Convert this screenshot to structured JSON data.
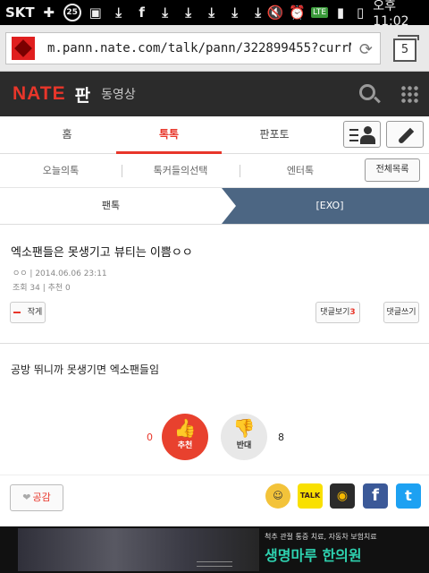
{
  "status_bar": {
    "carrier": "SKT",
    "badge": "25",
    "time": "오후 11:02",
    "lte": "LTE"
  },
  "browser": {
    "url": "m.pann.nate.com/talk/pann/322899455?currMenu=cl",
    "tab_count": "5"
  },
  "header": {
    "logo": "NATE",
    "section": "판",
    "video": "동영상"
  },
  "main_tabs": [
    "홈",
    "톡톡",
    "판포토"
  ],
  "sub_tabs": {
    "items": [
      "오늘의톡",
      "톡커들의선택",
      "엔터톡"
    ],
    "all_button": "전체목록"
  },
  "breadcrumb": {
    "left": "팬톡",
    "right": "[EXO]"
  },
  "post": {
    "title": "엑소팬들은 못생기고 뷰티는 이쁨ㅇㅇ",
    "meta": "ㅇㅇ | 2014.06.06 23:11",
    "stats": "조회 34 | 추천 0",
    "write_button": "작게",
    "comments_button": "댓글보기",
    "comments_count": "3",
    "write_comment_button": "댓글쓰기"
  },
  "content": {
    "text": "공방 뛰니까 못생기면 엑소팬들임"
  },
  "vote": {
    "up_label": "추천",
    "up_count": "0",
    "down_label": "반대",
    "down_count": "8"
  },
  "share": {
    "like_label": "공감",
    "talk_label": "TALK",
    "facebook_label": "f",
    "twitter_label": "t"
  },
  "ad": {
    "sub": "척추 관절 통증 치료, 자동차 보험치료",
    "title": "생명마루 한의원"
  }
}
